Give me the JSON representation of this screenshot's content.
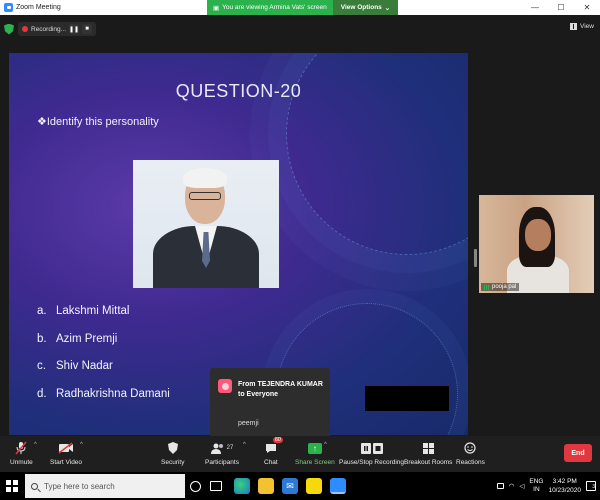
{
  "window": {
    "title": "Zoom Meeting",
    "share_banner_text": "You are viewing Armina Vats' screen",
    "view_options_label": "View Options",
    "minimize": "—",
    "maximize": "☐",
    "close": "✕"
  },
  "recording": {
    "status": "Recording...",
    "pause_icon": "❚❚",
    "stop_icon": "■"
  },
  "view_button": {
    "label": "View"
  },
  "slide": {
    "title": "QUESTION-20",
    "prompt": "❖Identify this personality",
    "options": [
      {
        "letter": "a.",
        "text": "Lakshmi Mittal"
      },
      {
        "letter": "b.",
        "text": "Azim Premji"
      },
      {
        "letter": "c.",
        "text": "Shiv Nadar"
      },
      {
        "letter": "d.",
        "text": "Radhakrishna Damani"
      }
    ]
  },
  "participant": {
    "name": "pooja pal"
  },
  "chat_toast": {
    "from": "From TEJENDRA KUMAR to Everyone",
    "message": "peemji"
  },
  "toolbar": {
    "unmute": "Unmute",
    "start_video": "Start Video",
    "security": "Security",
    "participants": "Participants",
    "participants_count": "27",
    "chat": "Chat",
    "chat_badge": "60",
    "share_screen": "Share Screen",
    "recording": "Pause/Stop Recording",
    "breakout": "Breakout Rooms",
    "reactions": "Reactions",
    "end": "End",
    "caret": "^"
  },
  "taskbar": {
    "search_placeholder": "Type here to search",
    "lang_top": "ENG",
    "lang_bottom": "IN",
    "time": "3:42 PM",
    "date": "10/23/2020",
    "notification_count": "3"
  },
  "colors": {
    "zoom_blue": "#2d8cff",
    "banner_green": "#2bb24c",
    "end_red": "#e0383e"
  }
}
